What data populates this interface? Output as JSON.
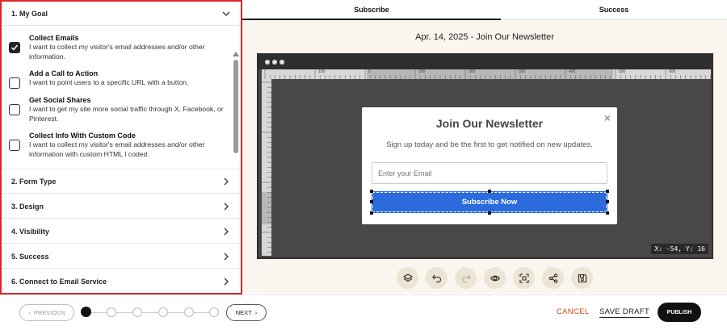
{
  "left_panel": {
    "goal_section": {
      "title": "1. My Goal"
    },
    "goals": [
      {
        "title": "Collect Emails",
        "desc": "I want to collect my visitor's email addresses and/or other information.",
        "checked": true
      },
      {
        "title": "Add a Call to Action",
        "desc": "I want to point users to a specific URL with a button.",
        "checked": false
      },
      {
        "title": "Get Social Shares",
        "desc": "I want to get my site more social traffic through X, Facebook, or Pinterest.",
        "checked": false
      },
      {
        "title": "Collect Info With Custom Code",
        "desc": "I want to collect my visitor's email addresses and/or other information with custom HTML I coded.",
        "checked": false
      }
    ],
    "sections": [
      "2. Form Type",
      "3. Design",
      "4. Visibility",
      "5. Success",
      "6. Connect to Email Service"
    ]
  },
  "tabs": [
    "Subscribe",
    "Success"
  ],
  "page_title": "Apr. 14, 2025 - Join Our Newsletter",
  "preview": {
    "ruler_labels": [
      "100",
      "0",
      "100",
      "200",
      "300",
      "400",
      "500",
      "600"
    ],
    "coord_readout": "X: -54, Y: 16"
  },
  "popup": {
    "close": "×",
    "title": "Join Our Newsletter",
    "subtitle": "Sign up today and be the first to get notified on new updates.",
    "email_placeholder": "Enter your Email",
    "button": "Subscribe Now"
  },
  "toolbar_icons": [
    "layers-icon",
    "undo-icon",
    "redo-icon",
    "preview-eye-icon",
    "fit-screen-icon",
    "share-icon",
    "save-icon"
  ],
  "bottom": {
    "previous": "PREVIOUS",
    "next": "NEXT",
    "step_count": 6,
    "active_step": 1,
    "cancel": "CANCEL",
    "save_draft": "SAVE DRAFT",
    "publish": "PUBLISH"
  }
}
